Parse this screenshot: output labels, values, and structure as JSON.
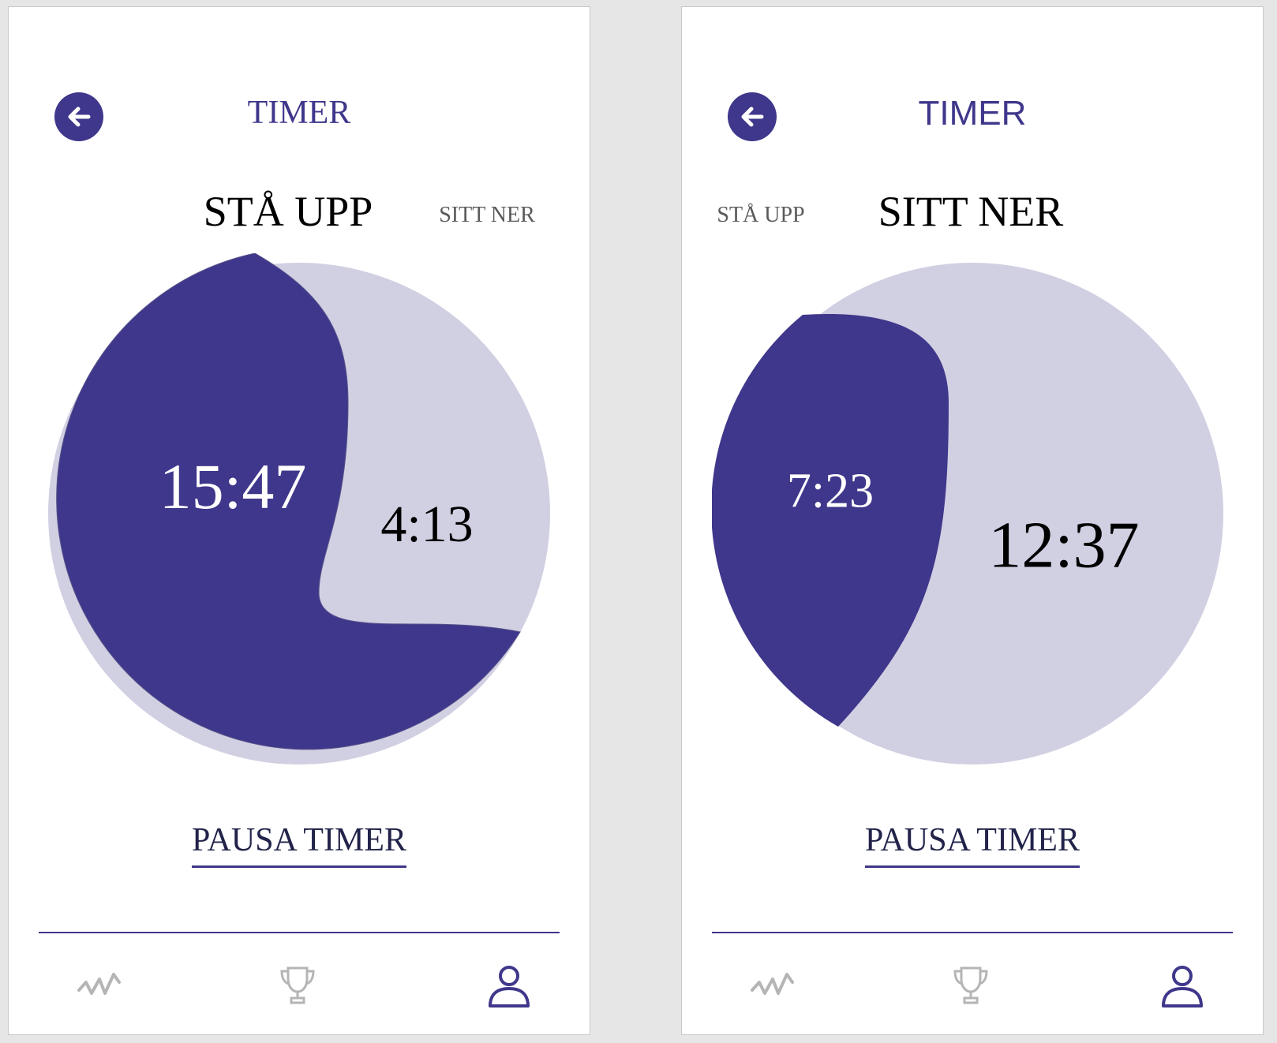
{
  "colors": {
    "accent": "#3f378b",
    "remaining": "#d1cfe2",
    "inactive_icon": "#b5b5b5"
  },
  "screens": [
    {
      "title": "TIMER",
      "mode_tabs": [
        {
          "label": "STÅ UPP",
          "active": true
        },
        {
          "label": "SITT NER",
          "active": false
        }
      ],
      "elapsed_time": "15:47",
      "remaining_time": "4:13",
      "elapsed_fraction": 0.79,
      "pause_label": "PAUSA TIMER",
      "nav": [
        {
          "icon": "activity-icon",
          "active": false
        },
        {
          "icon": "trophy-icon",
          "active": false
        },
        {
          "icon": "profile-icon",
          "active": true
        }
      ]
    },
    {
      "title": "TIMER",
      "mode_tabs": [
        {
          "label": "STÅ UPP",
          "active": false
        },
        {
          "label": "SITT NER",
          "active": true
        }
      ],
      "elapsed_time": "7:23",
      "remaining_time": "12:37",
      "elapsed_fraction": 0.37,
      "pause_label": "PAUSA TIMER",
      "nav": [
        {
          "icon": "activity-icon",
          "active": false
        },
        {
          "icon": "trophy-icon",
          "active": false
        },
        {
          "icon": "profile-icon",
          "active": true
        }
      ]
    }
  ]
}
